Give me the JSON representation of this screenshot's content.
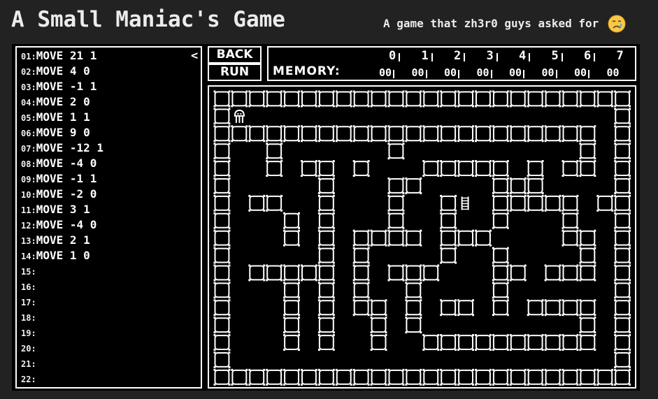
{
  "header": {
    "title": "A Small Maniac's Game",
    "subtitle": "A game that zh3r0 guys asked for"
  },
  "emoji": "crying-face-icon",
  "code": {
    "collapse_symbol": "<",
    "lines": [
      {
        "num": "01:",
        "text": "MOVE 21 1"
      },
      {
        "num": "02:",
        "text": "MOVE 4 0"
      },
      {
        "num": "03:",
        "text": "MOVE -1 1"
      },
      {
        "num": "04:",
        "text": "MOVE 2 0"
      },
      {
        "num": "05:",
        "text": "MOVE 1 1"
      },
      {
        "num": "06:",
        "text": "MOVE 9 0"
      },
      {
        "num": "07:",
        "text": "MOVE -12 1"
      },
      {
        "num": "08:",
        "text": "MOVE -4 0"
      },
      {
        "num": "09:",
        "text": "MOVE -1 1"
      },
      {
        "num": "10:",
        "text": "MOVE -2 0"
      },
      {
        "num": "11:",
        "text": "MOVE 3 1"
      },
      {
        "num": "12:",
        "text": "MOVE -4 0"
      },
      {
        "num": "13:",
        "text": "MOVE 2 1"
      },
      {
        "num": "14:",
        "text": "MOVE 1 0"
      },
      {
        "num": "15:",
        "text": ""
      },
      {
        "num": "16:",
        "text": ""
      },
      {
        "num": "17:",
        "text": ""
      },
      {
        "num": "18:",
        "text": ""
      },
      {
        "num": "19:",
        "text": ""
      },
      {
        "num": "20:",
        "text": ""
      },
      {
        "num": "21:",
        "text": ""
      },
      {
        "num": "22:",
        "text": ""
      }
    ]
  },
  "controls": {
    "back_label": "BACK",
    "run_label": "RUN"
  },
  "memory": {
    "label": "MEMORY:",
    "indices": [
      "0",
      "1",
      "2",
      "3",
      "4",
      "5",
      "6",
      "7"
    ],
    "values": [
      "00",
      "00",
      "00",
      "00",
      "00",
      "00",
      "00",
      "00"
    ]
  },
  "board": {
    "cols": 24,
    "rows": 17,
    "walls": [
      [
        1,
        0
      ],
      [
        1,
        23
      ],
      [
        2,
        0
      ],
      [
        2,
        1
      ],
      [
        2,
        2
      ],
      [
        2,
        3
      ],
      [
        2,
        4
      ],
      [
        2,
        5
      ],
      [
        2,
        6
      ],
      [
        2,
        7
      ],
      [
        2,
        8
      ],
      [
        2,
        9
      ],
      [
        2,
        10
      ],
      [
        2,
        11
      ],
      [
        2,
        12
      ],
      [
        2,
        13
      ],
      [
        2,
        14
      ],
      [
        2,
        15
      ],
      [
        2,
        16
      ],
      [
        2,
        17
      ],
      [
        2,
        18
      ],
      [
        2,
        19
      ],
      [
        2,
        20
      ],
      [
        2,
        21
      ],
      [
        2,
        23
      ],
      [
        3,
        0
      ],
      [
        3,
        3
      ],
      [
        3,
        10
      ],
      [
        3,
        21
      ],
      [
        3,
        23
      ],
      [
        4,
        0
      ],
      [
        4,
        3
      ],
      [
        4,
        5
      ],
      [
        4,
        6
      ],
      [
        4,
        8
      ],
      [
        4,
        12
      ],
      [
        4,
        13
      ],
      [
        4,
        14
      ],
      [
        4,
        15
      ],
      [
        4,
        16
      ],
      [
        4,
        18
      ],
      [
        4,
        20
      ],
      [
        4,
        21
      ],
      [
        4,
        23
      ],
      [
        5,
        0
      ],
      [
        5,
        6
      ],
      [
        5,
        10
      ],
      [
        5,
        11
      ],
      [
        5,
        16
      ],
      [
        5,
        17
      ],
      [
        5,
        18
      ],
      [
        5,
        23
      ],
      [
        6,
        0
      ],
      [
        6,
        2
      ],
      [
        6,
        3
      ],
      [
        6,
        6
      ],
      [
        6,
        10
      ],
      [
        6,
        13
      ],
      [
        6,
        16
      ],
      [
        6,
        17
      ],
      [
        6,
        18
      ],
      [
        6,
        19
      ],
      [
        6,
        20
      ],
      [
        6,
        22
      ],
      [
        6,
        23
      ],
      [
        7,
        0
      ],
      [
        7,
        4
      ],
      [
        7,
        6
      ],
      [
        7,
        10
      ],
      [
        7,
        13
      ],
      [
        7,
        16
      ],
      [
        7,
        20
      ],
      [
        7,
        23
      ],
      [
        8,
        0
      ],
      [
        8,
        4
      ],
      [
        8,
        6
      ],
      [
        8,
        8
      ],
      [
        8,
        9
      ],
      [
        8,
        10
      ],
      [
        8,
        11
      ],
      [
        8,
        13
      ],
      [
        8,
        14
      ],
      [
        8,
        15
      ],
      [
        8,
        20
      ],
      [
        8,
        21
      ],
      [
        8,
        23
      ],
      [
        9,
        0
      ],
      [
        9,
        6
      ],
      [
        9,
        8
      ],
      [
        9,
        13
      ],
      [
        9,
        16
      ],
      [
        9,
        21
      ],
      [
        9,
        23
      ],
      [
        10,
        0
      ],
      [
        10,
        2
      ],
      [
        10,
        3
      ],
      [
        10,
        4
      ],
      [
        10,
        5
      ],
      [
        10,
        6
      ],
      [
        10,
        8
      ],
      [
        10,
        10
      ],
      [
        10,
        11
      ],
      [
        10,
        12
      ],
      [
        10,
        16
      ],
      [
        10,
        17
      ],
      [
        10,
        19
      ],
      [
        10,
        20
      ],
      [
        10,
        21
      ],
      [
        10,
        23
      ],
      [
        11,
        0
      ],
      [
        11,
        4
      ],
      [
        11,
        6
      ],
      [
        11,
        8
      ],
      [
        11,
        11
      ],
      [
        11,
        16
      ],
      [
        11,
        23
      ],
      [
        12,
        0
      ],
      [
        12,
        4
      ],
      [
        12,
        6
      ],
      [
        12,
        8
      ],
      [
        12,
        9
      ],
      [
        12,
        11
      ],
      [
        12,
        13
      ],
      [
        12,
        14
      ],
      [
        12,
        16
      ],
      [
        12,
        18
      ],
      [
        12,
        19
      ],
      [
        12,
        20
      ],
      [
        12,
        21
      ],
      [
        12,
        23
      ],
      [
        13,
        0
      ],
      [
        13,
        4
      ],
      [
        13,
        6
      ],
      [
        13,
        9
      ],
      [
        13,
        11
      ],
      [
        13,
        21
      ],
      [
        13,
        23
      ],
      [
        14,
        0
      ],
      [
        14,
        4
      ],
      [
        14,
        6
      ],
      [
        14,
        9
      ],
      [
        14,
        12
      ],
      [
        14,
        13
      ],
      [
        14,
        14
      ],
      [
        14,
        15
      ],
      [
        14,
        16
      ],
      [
        14,
        17
      ],
      [
        14,
        18
      ],
      [
        14,
        19
      ],
      [
        14,
        20
      ],
      [
        14,
        21
      ],
      [
        14,
        23
      ],
      [
        15,
        0
      ],
      [
        15,
        23
      ]
    ],
    "player": {
      "row": 1,
      "col": 1,
      "icon": "player-ghost-icon"
    },
    "goal": {
      "row": 6,
      "col": 14,
      "icon": "ladder-icon"
    }
  }
}
